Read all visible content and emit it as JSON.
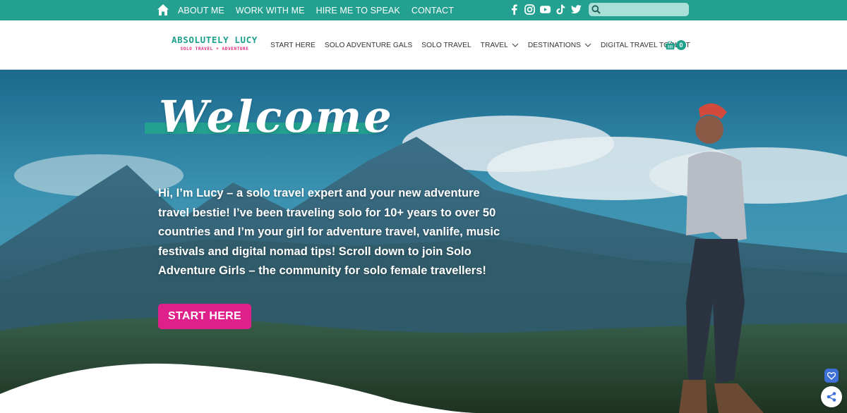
{
  "topbar": {
    "links": [
      "ABOUT ME",
      "WORK WITH ME",
      "HIRE ME TO SPEAK",
      "CONTACT"
    ],
    "social_icons": [
      "facebook-icon",
      "instagram-icon",
      "youtube-icon",
      "tiktok-icon",
      "twitter-icon"
    ],
    "search": {
      "placeholder": "",
      "value": ""
    },
    "colors": {
      "background": "#23a08f",
      "search_bg": "#a8e0d8"
    }
  },
  "header": {
    "logo": {
      "name": "ABSOLUTELY LUCY",
      "tagline": "SOLO TRAVEL + ADVENTURE"
    },
    "nav": [
      {
        "label": "START HERE",
        "dropdown": false
      },
      {
        "label": "SOLO ADVENTURE GALS",
        "dropdown": false
      },
      {
        "label": "SOLO TRAVEL",
        "dropdown": false
      },
      {
        "label": "TRAVEL",
        "dropdown": true
      },
      {
        "label": "DESTINATIONS",
        "dropdown": true
      },
      {
        "label": "DIGITAL TRAVEL TOOLKIT",
        "dropdown": false
      }
    ],
    "cart_count": "0",
    "colors": {
      "brand_teal": "#1fa08d",
      "brand_pink": "#e0287d"
    }
  },
  "hero": {
    "heading": "Welcome",
    "intro": "Hi, I’m Lucy – a solo travel expert and your new adventure travel bestie! I’ve been traveling solo for 10+ years to over 50 countries and I’m your girl for adventure travel, vanlife, music festivals and digital nomad tips! Scroll down to join Solo Adventure Girls – the community for solo female travellers!",
    "cta_label": "START HERE",
    "colors": {
      "cta": "#e0208a"
    }
  },
  "floating": {
    "icons": [
      "heart-icon",
      "share-icon"
    ]
  }
}
